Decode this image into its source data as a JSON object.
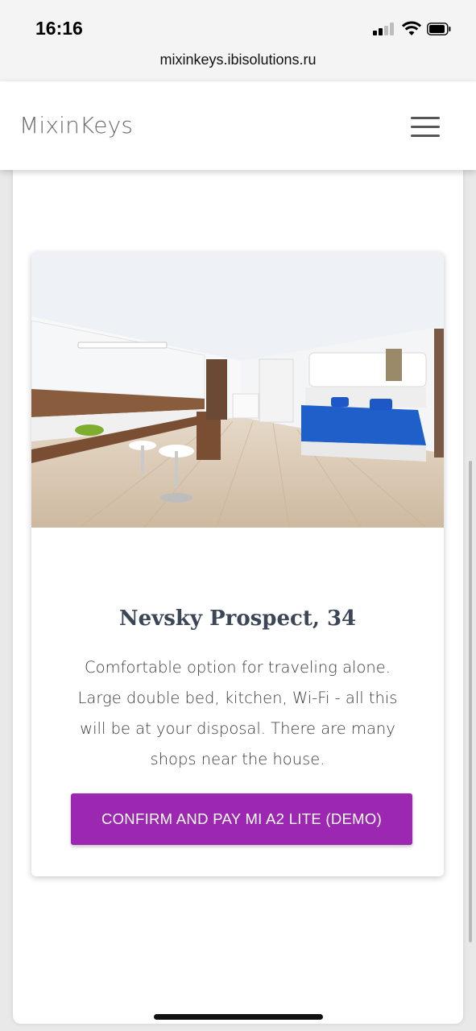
{
  "status_bar": {
    "time": "16:16",
    "url": "mixinkeys.ibisolutions.ru",
    "icons": [
      "cellular-signal-icon",
      "wifi-icon",
      "battery-icon"
    ]
  },
  "navbar": {
    "brand": "MixinKeys",
    "menu_icon": "hamburger-menu-icon"
  },
  "card": {
    "image_description": "apartment-photo",
    "title": "Nevsky Prospect, 34",
    "description": "Comfortable option for traveling alone. Large double bed, kitchen, Wi-Fi - all this will be at your disposal. There are many shops near the house.",
    "button_label": "CONFIRM AND PAY MI A2 LITE (DEMO)"
  },
  "colors": {
    "accent": "#9c27b0",
    "title": "#3b4657",
    "brand": "#6b6b6b"
  }
}
